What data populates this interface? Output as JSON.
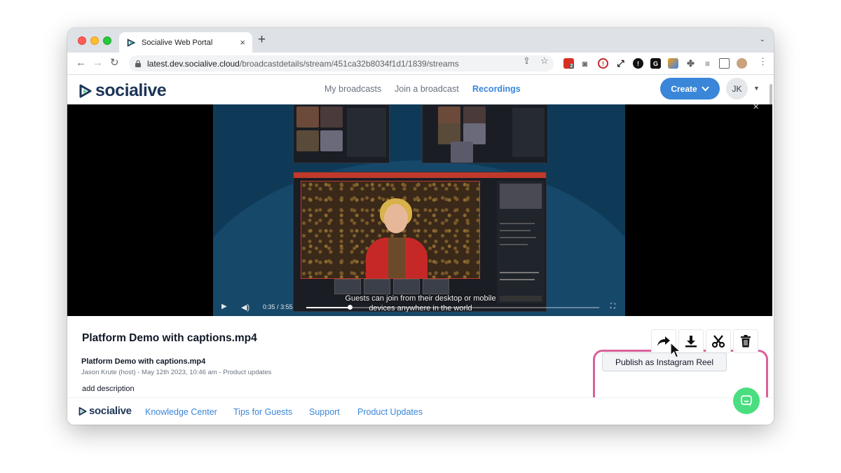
{
  "browser": {
    "tab_title": "Socialive Web Portal",
    "tab_close": "×",
    "new_tab": "+",
    "url_host": "latest.dev.socialive.cloud",
    "url_path": "/broadcastdetails/stream/451ca32b8034f1d1/1839/streams",
    "extension_badge": "2"
  },
  "header": {
    "logo": "socialive",
    "nav": [
      "My broadcasts",
      "Join a broadcast",
      "Recordings"
    ],
    "active_nav": "Recordings",
    "create_label": "Create",
    "avatar_initials": "JK"
  },
  "player": {
    "current_time": "0:35",
    "time_separator": "/",
    "duration": "3:55",
    "progress_fraction": 0.149,
    "caption": "Guests can join from their desktop or mobile devices anywhere in the world"
  },
  "recording": {
    "title": "Platform Demo with captions.mp4",
    "subtitle": "Platform Demo with captions.mp4",
    "meta": "Jason Krute (host) - May 12th 2023, 10:46 am - Product updates",
    "description_placeholder": "add description"
  },
  "actions": {
    "tooltip": "Publish as Instagram Reel",
    "buttons": [
      "share-icon",
      "download-icon",
      "scissors-icon",
      "trash-icon"
    ]
  },
  "footer": {
    "logo": "socialive",
    "links": [
      "Knowledge Center",
      "Tips for Guests",
      "Support",
      "Product Updates"
    ]
  },
  "colors": {
    "brand_blue": "#3a86d9",
    "highlight_pink": "#d9619a",
    "chat_green": "#4ade80"
  }
}
